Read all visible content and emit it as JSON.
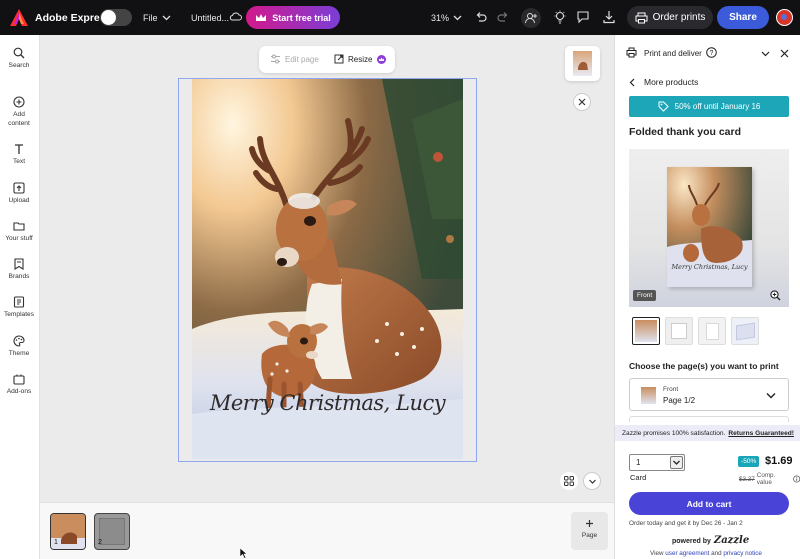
{
  "topbar": {
    "app_name": "Adobe Express",
    "file_label": "File",
    "doc_title": "Untitled...",
    "trial_label": "Start free trial",
    "zoom": "31%",
    "order_prints": "Order prints",
    "share": "Share"
  },
  "sidebar": {
    "items": [
      {
        "label": "Search",
        "icon": "search-icon"
      },
      {
        "label": "Add content",
        "icon": "plus-circle-icon"
      },
      {
        "label": "Text",
        "icon": "text-icon"
      },
      {
        "label": "Upload",
        "icon": "upload-icon"
      },
      {
        "label": "Your stuff",
        "icon": "folder-icon"
      },
      {
        "label": "Brands",
        "icon": "brand-icon"
      },
      {
        "label": "Templates",
        "icon": "templates-icon"
      },
      {
        "label": "Theme",
        "icon": "palette-icon"
      },
      {
        "label": "Add-ons",
        "icon": "addons-icon"
      }
    ]
  },
  "canvas": {
    "edit_page": "Edit page",
    "resize": "Resize",
    "card_text": "Merry Christmas, Lucy"
  },
  "pages": {
    "thumbs": [
      "1",
      "2"
    ],
    "add_page": "Page"
  },
  "panel": {
    "header": "Print and deliver",
    "back_label": "More products",
    "promo": "50% off until January 16",
    "product_title": "Folded thank you card",
    "front_badge": "Front",
    "choose_label": "Choose the page(s) you want to print",
    "page_select": {
      "small": "Front",
      "value": "Page 1/2"
    },
    "guarantee_text": "Zazzle promises 100% satisfaction.",
    "guarantee_link": "Returns Guaranteed!",
    "quantity": "1",
    "quantity_label": "Card",
    "discount": "-50%",
    "price": "$1.69",
    "old_price": "$3.37",
    "comp_value": "Comp. value",
    "add_to_cart": "Add to cart",
    "delivery": "Order today and get it by Dec 26 - Jan 2",
    "powered_by": "powered by",
    "brand": "Zazzle",
    "view_text": "View",
    "user_agreement": "user agreement",
    "and_text": "and",
    "privacy_notice": "privacy notice"
  },
  "colors": {
    "trial_gradient_start": "#d3198c",
    "trial_gradient_end": "#7a3ed6",
    "share": "#3b5bdb",
    "promo": "#1ca6b8",
    "cart": "#4a43d8",
    "discount": "#19a6b8"
  }
}
